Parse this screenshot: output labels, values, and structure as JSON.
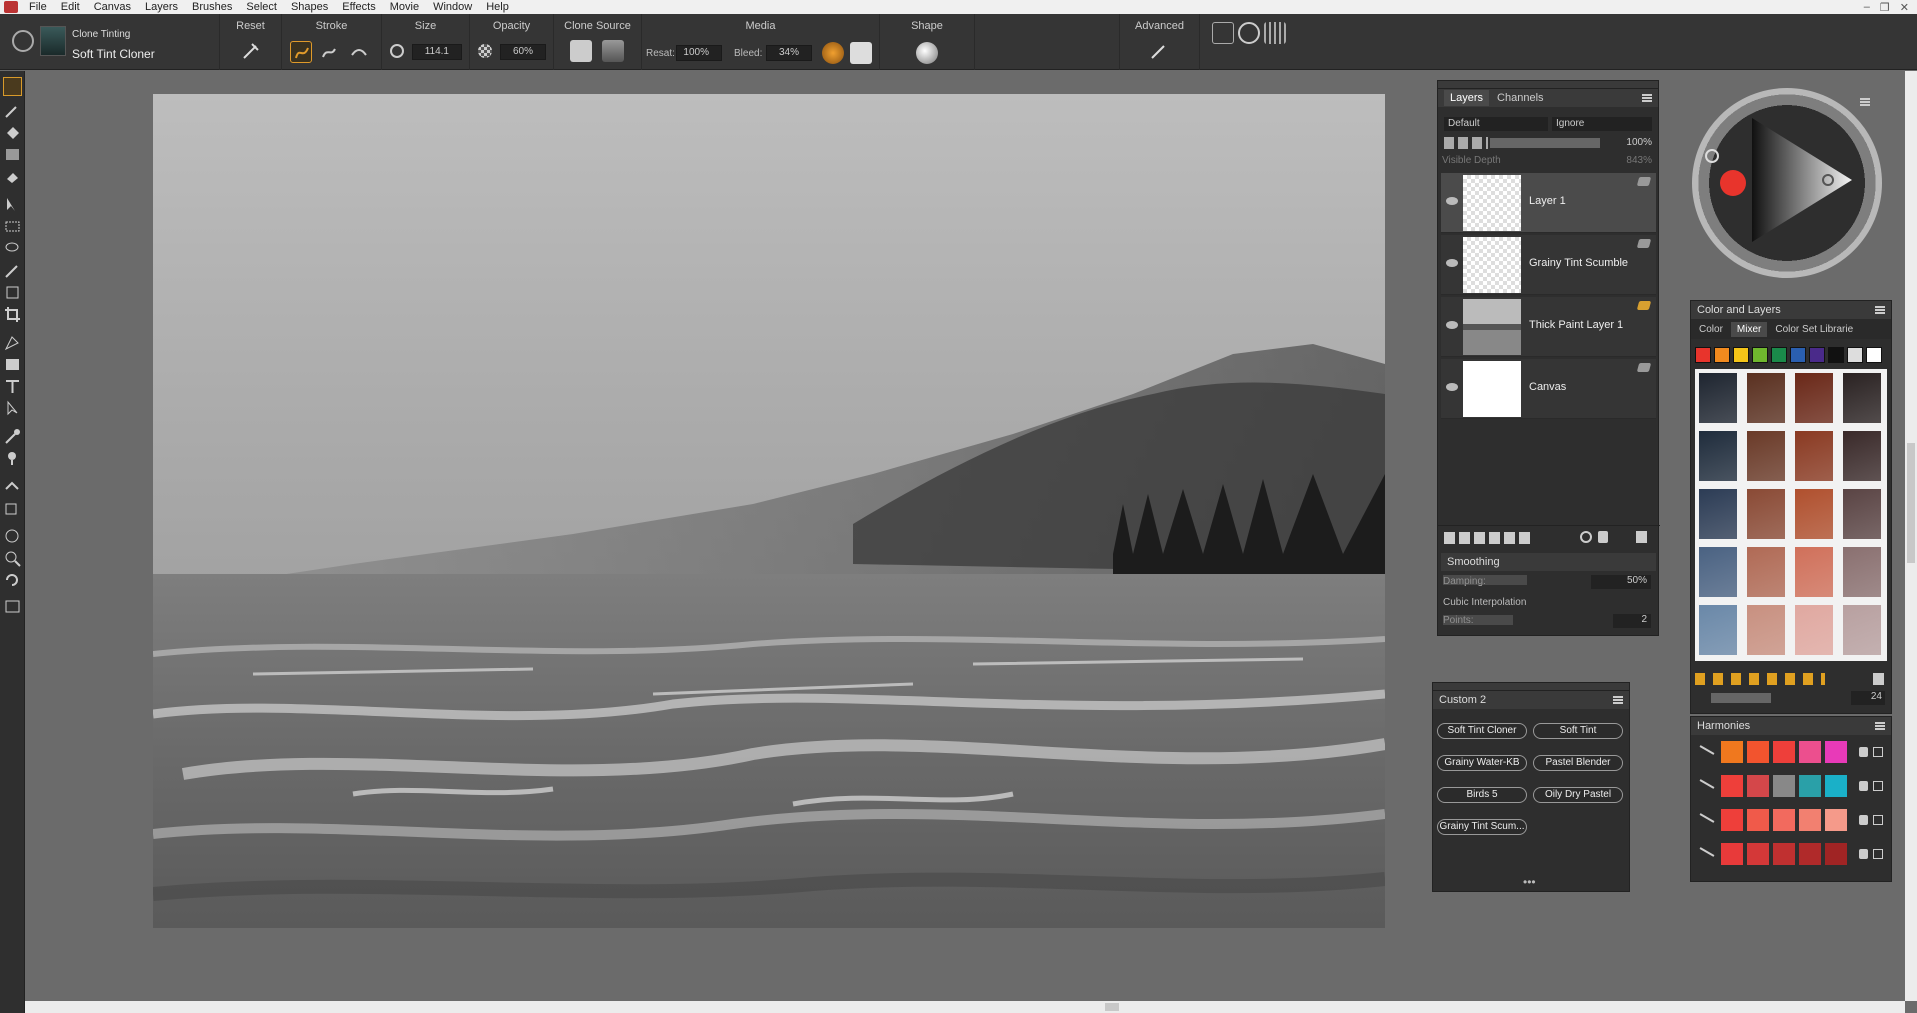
{
  "menu": [
    "File",
    "Edit",
    "Canvas",
    "Layers",
    "Brushes",
    "Select",
    "Shapes",
    "Effects",
    "Movie",
    "Window",
    "Help"
  ],
  "brush": {
    "category": "Clone Tinting",
    "variant": "Soft Tint Cloner"
  },
  "propbar": {
    "reset": "Reset",
    "stroke": "Stroke",
    "size": "Size",
    "size_value": "114.1",
    "opacity": "Opacity",
    "opacity_value": "60%",
    "clone_source": "Clone Source",
    "media": "Media",
    "resat_label": "Resat:",
    "resat_value": "100%",
    "bleed_label": "Bleed:",
    "bleed_value": "34%",
    "shape": "Shape",
    "advanced": "Advanced"
  },
  "layers_panel": {
    "tabs": [
      "Layers",
      "Channels"
    ],
    "composite_method": "Default",
    "preserve": "Ignore",
    "opacity_value": "100%",
    "visible_depth_label": "Visible Depth",
    "visible_depth_value": "843%",
    "layers": [
      {
        "name": "Layer 1",
        "thumb": "transparent",
        "selected": true
      },
      {
        "name": "Grainy Tint Scumble",
        "thumb": "transparent",
        "selected": false
      },
      {
        "name": "Thick Paint Layer 1",
        "thumb": "landscape",
        "selected": false
      },
      {
        "name": "Canvas",
        "thumb": "white",
        "selected": false
      }
    ]
  },
  "smoothing_panel": {
    "title": "Smoothing",
    "damping_label": "Damping:",
    "damping_value": "50%",
    "cubic_label": "Cubic Interpolation",
    "points_label": "Points:",
    "points_value": "2"
  },
  "custom_panel": {
    "title": "Custom 2",
    "buttons": [
      "Soft Tint Cloner",
      "Soft Tint",
      "Grainy Water-KB",
      "Pastel Blender",
      "Birds 5",
      "Oily Dry Pastel",
      "Grainy Tint Scum..."
    ]
  },
  "color_layers_panel": {
    "title": "Color and Layers",
    "tabs": [
      "Color",
      "Mixer",
      "Color Set Librarie"
    ],
    "mixer_colors": [
      "#e8342c",
      "#f28a1e",
      "#f5c518",
      "#6fb82e",
      "#1a8a4a",
      "#2a5fb0",
      "#4a2a8a",
      "#111111",
      "#dddddd",
      "#ffffff"
    ],
    "brush_size_value": "24"
  },
  "harmonies_panel": {
    "title": "Harmonies",
    "rows": [
      [
        "#f0781e",
        "#f2542e",
        "#ee3f3a",
        "#ec4f8e",
        "#e83ab8"
      ],
      [
        "#ee3f3a",
        "#d4474a",
        "#888888",
        "#2aa0a8",
        "#1ab0c8"
      ],
      [
        "#ee3f3a",
        "#f05a4a",
        "#f26a5e",
        "#f28070",
        "#f59a8a"
      ],
      [
        "#e83a3a",
        "#d43838",
        "#c03030",
        "#b02a2a",
        "#a02424"
      ]
    ]
  }
}
